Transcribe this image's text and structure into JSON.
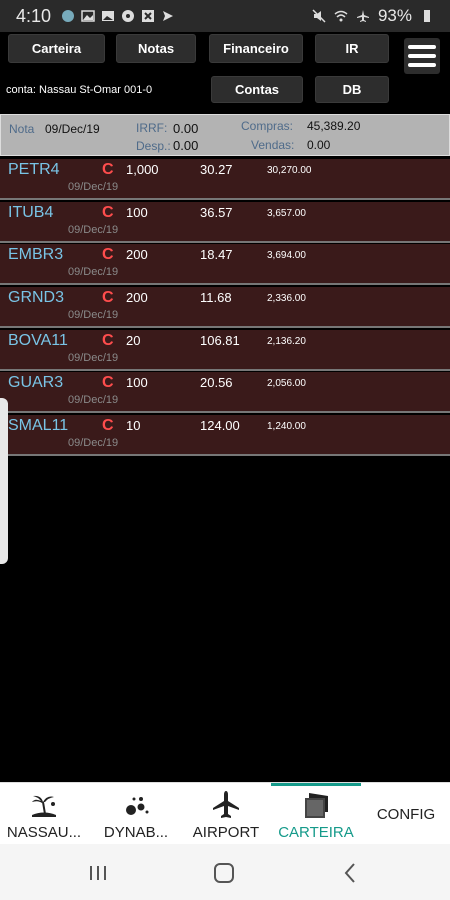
{
  "status": {
    "time": "4:10",
    "battery": "93%"
  },
  "toolbar": {
    "carteira": "Carteira",
    "notas": "Notas",
    "financeiro": "Financeiro",
    "ir": "IR",
    "contas": "Contas",
    "db": "DB"
  },
  "account": {
    "label": "conta: Nassau St-Omar 001-0"
  },
  "summary": {
    "nota_label": "Nota",
    "nota_date": "09/Dec/19",
    "irrf_label": "IRRF:",
    "irrf_value": "0.00",
    "desp_label": "Desp.:",
    "desp_value": "0.00",
    "compras_label": "Compras:",
    "compras_value": "45,389.20",
    "vendas_label": "Vendas:",
    "vendas_value": "0.00"
  },
  "rows": [
    {
      "ticker": "PETR4",
      "type": "C",
      "qty": "1,000",
      "price": "30.27",
      "total": "30,270.00",
      "date": "09/Dec/19"
    },
    {
      "ticker": "ITUB4",
      "type": "C",
      "qty": "100",
      "price": "36.57",
      "total": "3,657.00",
      "date": "09/Dec/19"
    },
    {
      "ticker": "EMBR3",
      "type": "C",
      "qty": "200",
      "price": "18.47",
      "total": "3,694.00",
      "date": "09/Dec/19"
    },
    {
      "ticker": "GRND3",
      "type": "C",
      "qty": "200",
      "price": "11.68",
      "total": "2,336.00",
      "date": "09/Dec/19"
    },
    {
      "ticker": "BOVA11",
      "type": "C",
      "qty": "20",
      "price": "106.81",
      "total": "2,136.20",
      "date": "09/Dec/19"
    },
    {
      "ticker": "GUAR3",
      "type": "C",
      "qty": "100",
      "price": "20.56",
      "total": "2,056.00",
      "date": "09/Dec/19"
    },
    {
      "ticker": "SMAL11",
      "type": "C",
      "qty": "10",
      "price": "124.00",
      "total": "1,240.00",
      "date": "09/Dec/19"
    }
  ],
  "nav": {
    "nassau": "NASSAU...",
    "dynab": "DYNAB...",
    "airport": "AIRPORT",
    "carteira": "CARTEIRA",
    "config": "CONFIG"
  },
  "colors": {
    "accent": "#159a8a",
    "row_bg": "#3a1a1a",
    "ticker": "#79c4e6",
    "type": "#ff4d4d"
  }
}
